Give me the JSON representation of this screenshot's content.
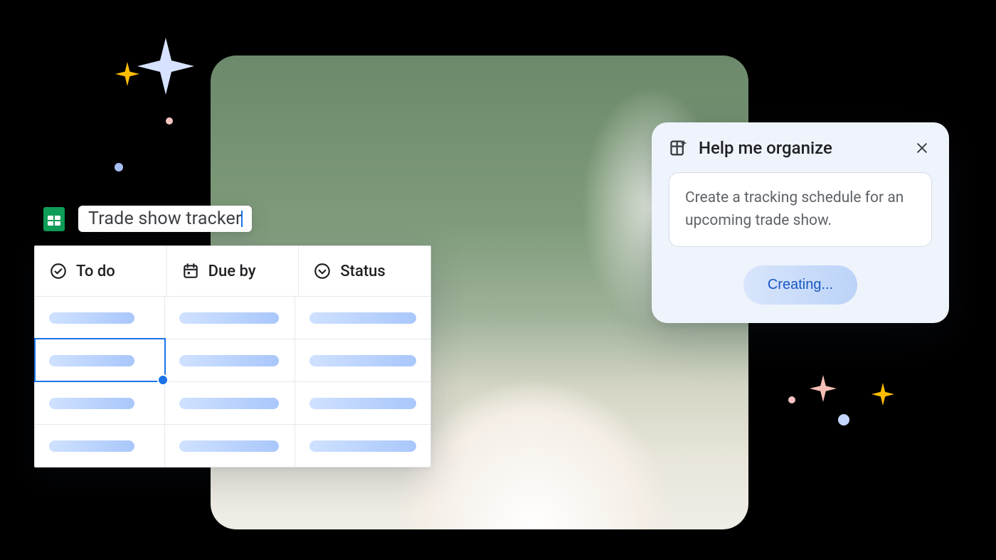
{
  "document": {
    "title": "Trade show tracker"
  },
  "columns": [
    {
      "icon": "check-circle-icon",
      "label": "To do"
    },
    {
      "icon": "calendar-icon",
      "label": "Due by"
    },
    {
      "icon": "chevron-circle-icon",
      "label": "Status"
    }
  ],
  "selected_cell": {
    "row": 1,
    "col": 0
  },
  "panel": {
    "title": "Help me organize",
    "prompt": "Create a tracking schedule for an upcoming trade show.",
    "action_label": "Creating..."
  }
}
